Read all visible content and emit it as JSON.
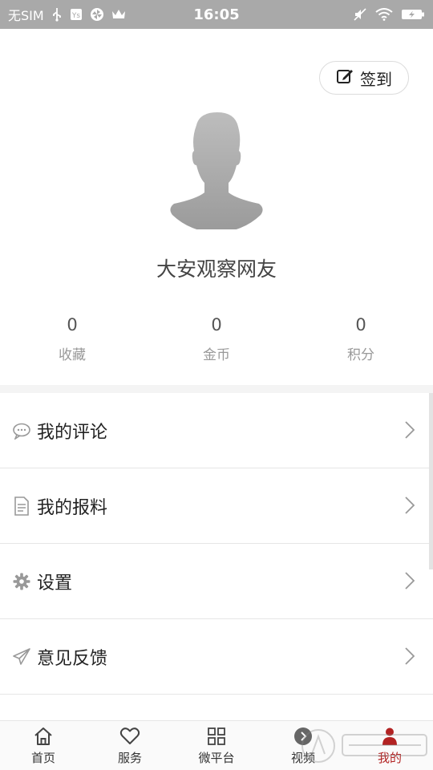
{
  "status_bar": {
    "carrier": "无SIM",
    "time": "16:05",
    "icons": [
      "usb-icon",
      "app-badge-icon",
      "pinwheel-icon",
      "crown-icon",
      "mute-icon",
      "wifi-icon",
      "battery-charging-icon"
    ]
  },
  "profile": {
    "checkin_label": "签到",
    "username": "大安观察网友",
    "stats": [
      {
        "value": "0",
        "label": "收藏"
      },
      {
        "value": "0",
        "label": "金币"
      },
      {
        "value": "0",
        "label": "积分"
      }
    ]
  },
  "menu": {
    "items": [
      {
        "label": "我的评论",
        "icon": "comment-icon"
      },
      {
        "label": "我的报料",
        "icon": "document-icon"
      },
      {
        "label": "设置",
        "icon": "gear-icon"
      },
      {
        "label": "意见反馈",
        "icon": "paper-plane-icon"
      }
    ]
  },
  "bottom_nav": {
    "items": [
      {
        "label": "首页",
        "icon": "home-icon"
      },
      {
        "label": "服务",
        "icon": "heart-icon"
      },
      {
        "label": "微平台",
        "icon": "grid-icon"
      },
      {
        "label": "视频",
        "icon": "play-icon"
      },
      {
        "label": "我的",
        "icon": "person-icon",
        "active": true
      }
    ]
  },
  "colors": {
    "status_bar_bg": "#a9a9a9",
    "active_nav": "#b22222",
    "text_primary": "#222222",
    "text_secondary": "#999999"
  }
}
